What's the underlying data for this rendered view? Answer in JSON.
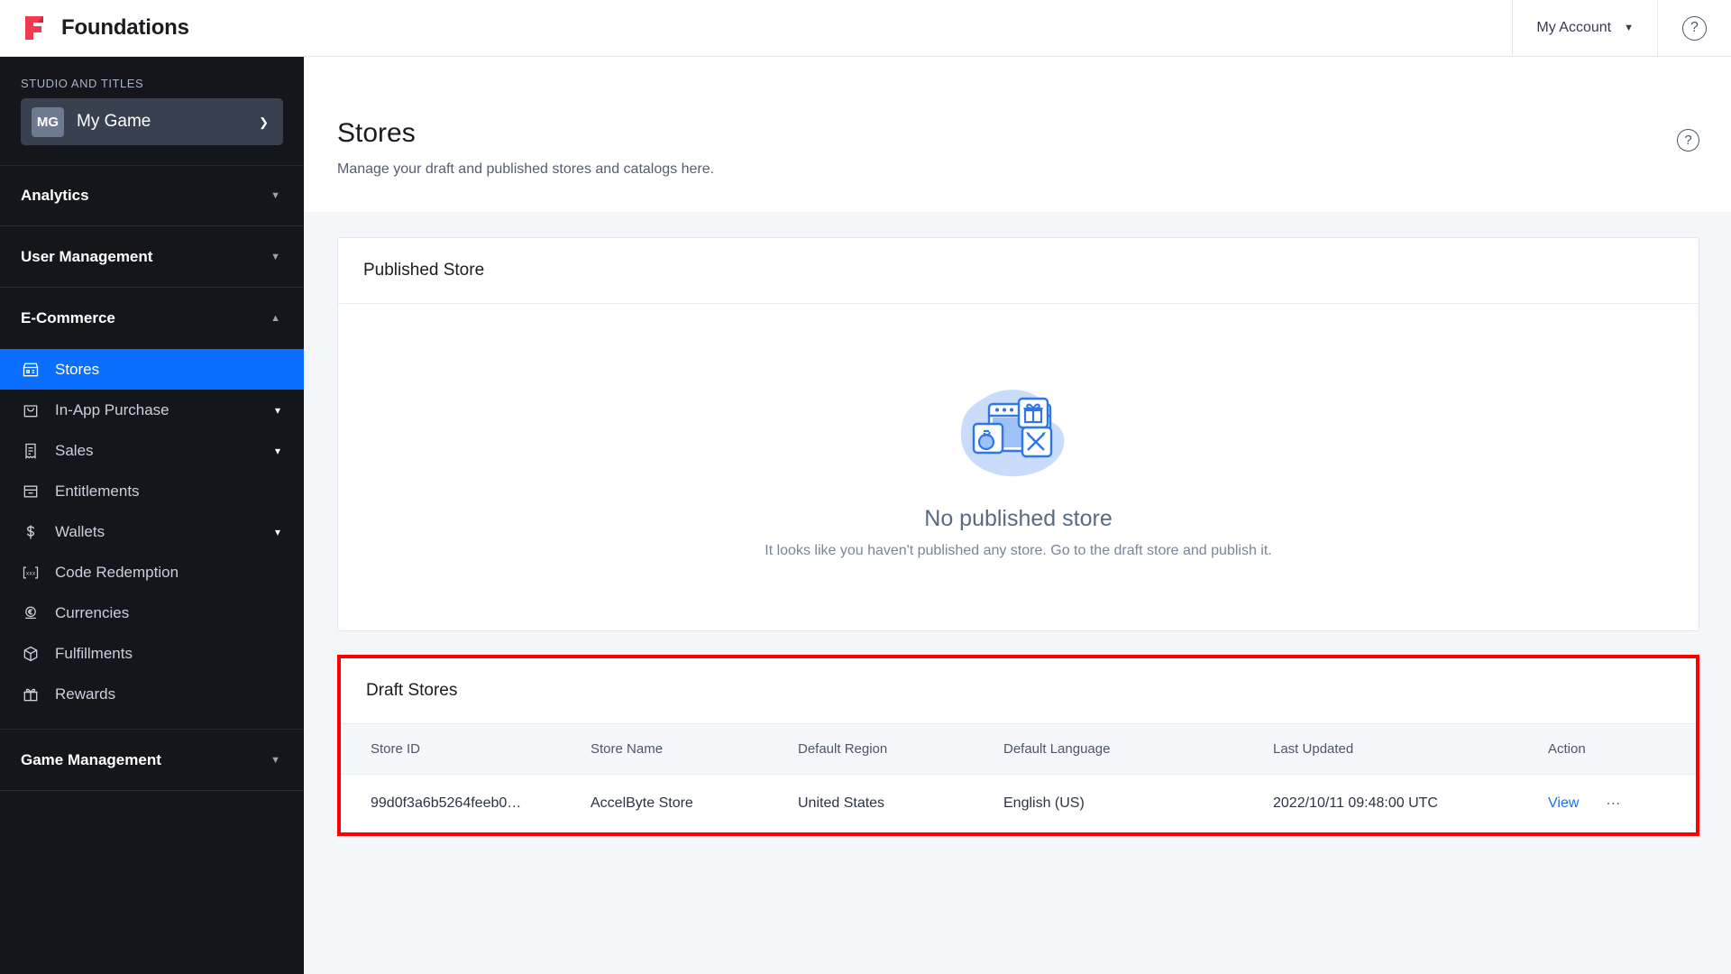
{
  "topbar": {
    "brand": "Foundations",
    "brand_logo_icon": "foundations-logo-icon",
    "brand_color": "#ef3a52",
    "account_label": "My Account",
    "account_caret_icon": "chevron-down-icon",
    "help_icon": "help-circle-icon",
    "help_glyph": "?"
  },
  "sidebar": {
    "section_label": "STUDIO AND TITLES",
    "game": {
      "initials": "MG",
      "name": "My Game",
      "chevron_icon": "chevron-down-icon"
    },
    "groups": [
      {
        "label": "Analytics",
        "icon": "triangle-down-icon",
        "expanded": false
      },
      {
        "label": "User Management",
        "icon": "triangle-down-icon",
        "expanded": false
      },
      {
        "label": "E-Commerce",
        "icon": "triangle-up-icon",
        "expanded": true
      },
      {
        "label": "Game Management",
        "icon": "triangle-down-icon",
        "expanded": false
      }
    ],
    "ecommerce_items": [
      {
        "label": "Stores",
        "icon": "store-icon",
        "active": true,
        "chevron": ""
      },
      {
        "label": "In-App Purchase",
        "icon": "shopping-bag-icon",
        "active": false,
        "chevron": "chevron-down-icon"
      },
      {
        "label": "Sales",
        "icon": "receipt-icon",
        "active": false,
        "chevron": "chevron-down-icon"
      },
      {
        "label": "Entitlements",
        "icon": "entitlement-icon",
        "active": false,
        "chevron": ""
      },
      {
        "label": "Wallets",
        "icon": "dollar-icon",
        "active": false,
        "chevron": "chevron-down-icon"
      },
      {
        "label": "Code Redemption",
        "icon": "code-brackets-icon",
        "active": false,
        "chevron": ""
      },
      {
        "label": "Currencies",
        "icon": "currency-coin-icon",
        "active": false,
        "chevron": ""
      },
      {
        "label": "Fulfillments",
        "icon": "box-icon",
        "active": false,
        "chevron": ""
      },
      {
        "label": "Rewards",
        "icon": "gift-icon",
        "active": false,
        "chevron": ""
      }
    ],
    "active_color": "#0a6fff"
  },
  "page": {
    "title": "Stores",
    "subtitle": "Manage your draft and published stores and catalogs here.",
    "help_icon": "help-circle-icon",
    "help_glyph": "?"
  },
  "published_store": {
    "card_title": "Published Store",
    "illustration_icon": "empty-store-illustration",
    "empty_title": "No published store",
    "empty_subtitle": "It looks like you haven't published any store. Go to the draft store and publish it."
  },
  "draft_stores": {
    "card_title": "Draft Stores",
    "highlight_color": "#ff0000",
    "columns": [
      "Store ID",
      "Store Name",
      "Default Region",
      "Default Language",
      "Last Updated",
      "Action"
    ],
    "rows": [
      {
        "store_id": "99d0f3a6b5264feeb0…",
        "store_name": "AccelByte Store",
        "default_region": "United States",
        "default_language": "English (US)",
        "last_updated": "2022/10/11 09:48:00 UTC",
        "action_label": "View",
        "more_icon": "ellipsis-icon",
        "more_glyph": "⋯"
      }
    ]
  }
}
